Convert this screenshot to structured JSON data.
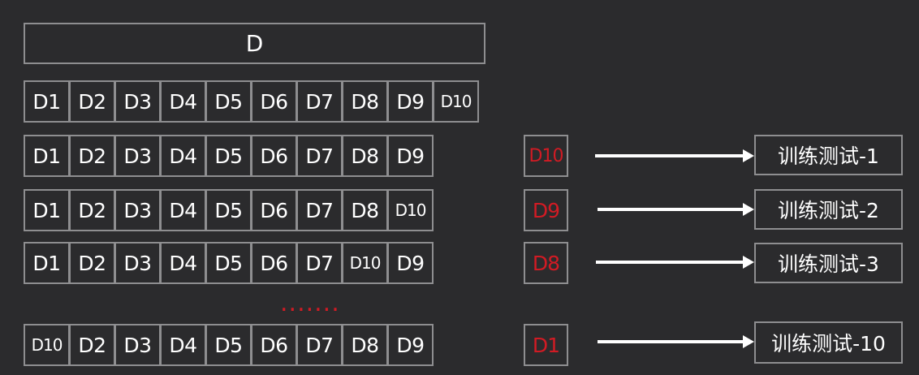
{
  "whole_label": "D",
  "full_row": [
    "D1",
    "D2",
    "D3",
    "D4",
    "D5",
    "D6",
    "D7",
    "D8",
    "D9",
    "D10"
  ],
  "folds": [
    {
      "train": [
        "D1",
        "D2",
        "D3",
        "D4",
        "D5",
        "D6",
        "D7",
        "D8",
        "D9"
      ],
      "holdout": "D10",
      "result": "训练测试-1"
    },
    {
      "train": [
        "D1",
        "D2",
        "D3",
        "D4",
        "D5",
        "D6",
        "D7",
        "D8",
        "D10"
      ],
      "holdout": "D9",
      "result": "训练测试-2"
    },
    {
      "train": [
        "D1",
        "D2",
        "D3",
        "D4",
        "D5",
        "D6",
        "D7",
        "D10",
        "D9"
      ],
      "holdout": "D8",
      "result": "训练测试-3"
    },
    {
      "train": [
        "D10",
        "D2",
        "D3",
        "D4",
        "D5",
        "D6",
        "D7",
        "D8",
        "D9"
      ],
      "holdout": "D1",
      "result": "训练测试-10"
    }
  ],
  "ellipsis": ".......",
  "colors": {
    "background": "#2b2b2d",
    "border": "#8e8e90",
    "text": "#ffffff",
    "highlight": "#d11b24"
  }
}
